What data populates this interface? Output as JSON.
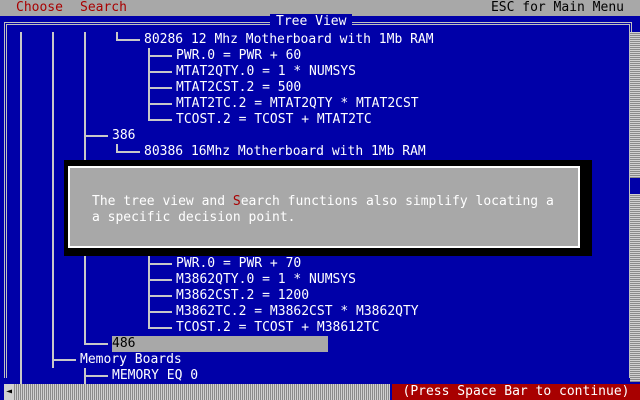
{
  "menubar": {
    "choose": "Choose",
    "search": "Search",
    "esc": "ESC for Main Menu"
  },
  "window": {
    "title": "Tree View"
  },
  "tree": {
    "n80286": "80286 12 Mhz Motherboard with 1Mb RAM",
    "pwr0": "PWR.0 = PWR + 60",
    "mtat2qty": "MTAT2QTY.0 = 1 * NUMSYS",
    "mtat2cst": "MTAT2CST.2 = 500",
    "mtat2tc": "MTAT2TC.2 = MTAT2QTY * MTAT2CST",
    "tcost2a": "TCOST.2 = TCOST + MTAT2TC",
    "n386": "386",
    "n80386": "80386 16Mhz Motherboard with 1Mb RAM",
    "pwr0b": "PWR.0 = PWR + 70",
    "m3862qty": "M3862QTY.0 = 1 * NUMSYS",
    "m3862cst": "M3862CST.2 = 1200",
    "m3862tc": "M3862TC.2 = M3862CST * M3862QTY",
    "tcost2b": "TCOST.2 = TCOST + M38612TC",
    "n486": "486",
    "memory_boards": "Memory Boards",
    "memory_eq": "MEMORY EQ 0"
  },
  "popup": {
    "line1_pre": "The tree view and ",
    "line1_hl": "S",
    "line1_post": "earch functions also simplify locating a",
    "line2": "a specific decision point."
  },
  "status": "(Press Space Bar to continue)",
  "colors": {
    "background": "#0000a8",
    "menubar": "#a8a8a8",
    "hotkey": "#a80000",
    "status": "#a80000",
    "popup": "#a8a8a8"
  }
}
